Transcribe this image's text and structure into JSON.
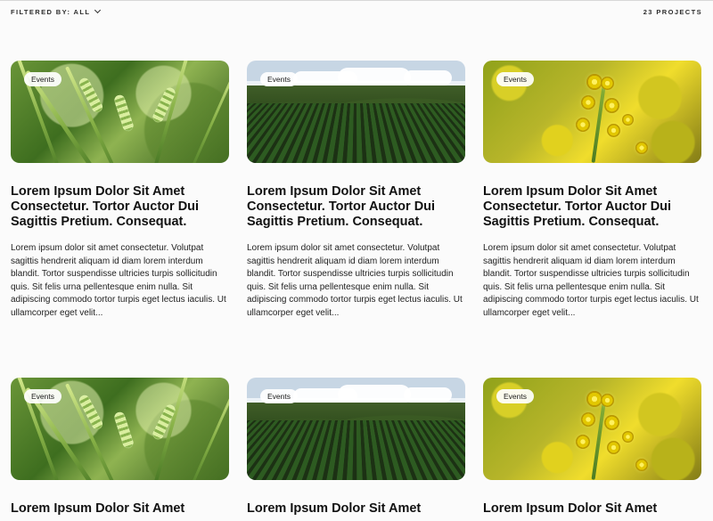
{
  "filter": {
    "label": "FILTERED BY: ALL"
  },
  "projects": {
    "count_label": "23 PROJECTS"
  },
  "cards": [
    {
      "badge": "Events",
      "title": "Lorem Ipsum Dolor Sit Amet Consectetur. Tortor Auctor Dui Sagittis Pretium. Consequat.",
      "excerpt": "Lorem ipsum dolor sit amet consectetur. Volutpat sagittis hendrerit aliquam id diam lorem interdum blandit. Tortor suspendisse ultricies turpis sollicitudin quis. Sit felis urna pellentesque enim nulla. Sit adipiscing commodo tortor turpis eget lectus iaculis. Ut ullamcorper eget velit..."
    },
    {
      "badge": "Events",
      "title": "Lorem Ipsum Dolor Sit Amet Consectetur. Tortor Auctor Dui Sagittis Pretium. Consequat.",
      "excerpt": "Lorem ipsum dolor sit amet consectetur. Volutpat sagittis hendrerit aliquam id diam lorem interdum blandit. Tortor suspendisse ultricies turpis sollicitudin quis. Sit felis urna pellentesque enim nulla. Sit adipiscing commodo tortor turpis eget lectus iaculis. Ut ullamcorper eget velit..."
    },
    {
      "badge": "Events",
      "title": "Lorem Ipsum Dolor Sit Amet Consectetur. Tortor Auctor Dui Sagittis Pretium. Consequat.",
      "excerpt": "Lorem ipsum dolor sit amet consectetur. Volutpat sagittis hendrerit aliquam id diam lorem interdum blandit. Tortor suspendisse ultricies turpis sollicitudin quis. Sit felis urna pellentesque enim nulla. Sit adipiscing commodo tortor turpis eget lectus iaculis. Ut ullamcorper eget velit..."
    },
    {
      "badge": "Events",
      "title": "Lorem Ipsum Dolor Sit Amet"
    },
    {
      "badge": "Events",
      "title": "Lorem Ipsum Dolor Sit Amet"
    },
    {
      "badge": "Events",
      "title": "Lorem Ipsum Dolor Sit Amet"
    }
  ],
  "icons": {
    "filter_chevron": "chevron-down-icon"
  }
}
